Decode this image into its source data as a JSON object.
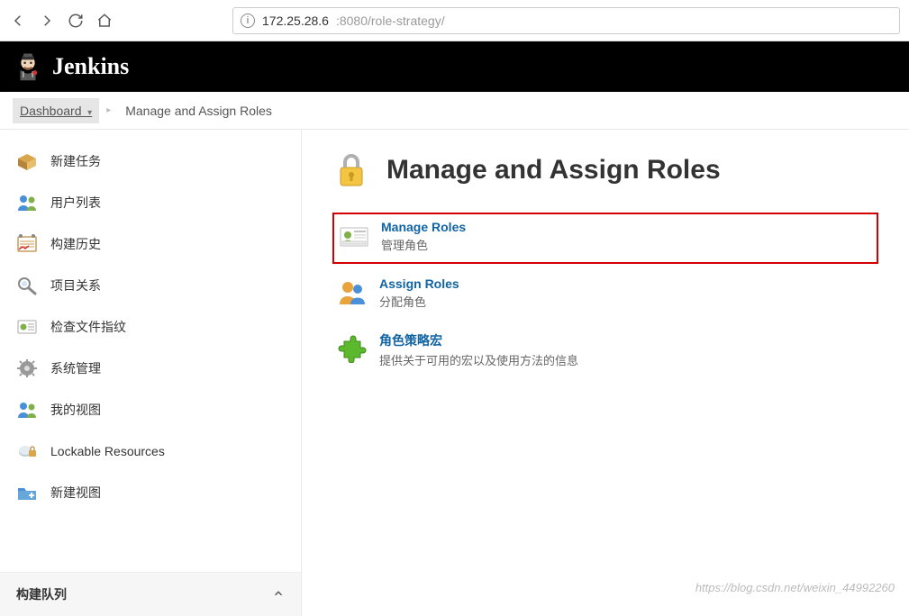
{
  "browser": {
    "url_host": "172.25.28.6",
    "url_rest": ":8080/role-strategy/"
  },
  "header": {
    "app_name": "Jenkins"
  },
  "breadcrumb": {
    "items": [
      {
        "label": "Dashboard",
        "has_caret": true,
        "selected": true
      },
      {
        "label": "Manage and Assign Roles",
        "has_caret": false,
        "selected": false
      }
    ]
  },
  "sidebar": {
    "items": [
      {
        "label": "新建任务",
        "icon": "package-icon"
      },
      {
        "label": "用户列表",
        "icon": "users-icon"
      },
      {
        "label": "构建历史",
        "icon": "history-icon"
      },
      {
        "label": "项目关系",
        "icon": "search-icon"
      },
      {
        "label": "检查文件指纹",
        "icon": "fingerprint-icon"
      },
      {
        "label": "系统管理",
        "icon": "gear-icon"
      },
      {
        "label": "我的视图",
        "icon": "users-icon"
      },
      {
        "label": "Lockable Resources",
        "icon": "lock-resource-icon"
      },
      {
        "label": "新建视图",
        "icon": "folder-plus-icon"
      }
    ],
    "queue_label": "构建队列"
  },
  "main": {
    "title": "Manage and Assign Roles",
    "options": [
      {
        "title": "Manage Roles",
        "desc": "管理角色",
        "highlighted": true,
        "icon": "id-card-icon"
      },
      {
        "title": "Assign Roles",
        "desc": "分配角色",
        "highlighted": false,
        "icon": "people-icon"
      },
      {
        "title": "角色策略宏",
        "desc": "提供关于可用的宏以及使用方法的信息",
        "highlighted": false,
        "icon": "puzzle-icon"
      }
    ]
  },
  "watermark": "https://blog.csdn.net/weixin_44992260"
}
